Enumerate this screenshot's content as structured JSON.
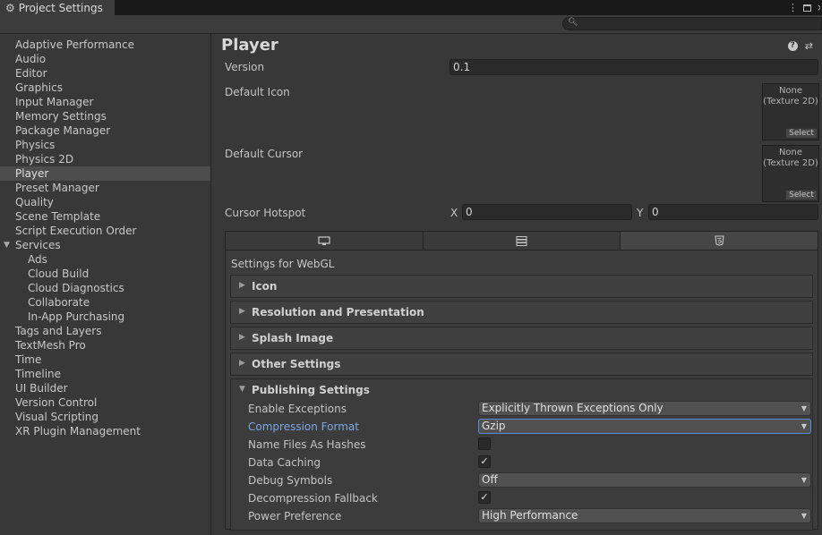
{
  "window": {
    "title": "Project Settings"
  },
  "sidebar": {
    "items": [
      {
        "label": "Adaptive Performance"
      },
      {
        "label": "Audio"
      },
      {
        "label": "Editor"
      },
      {
        "label": "Graphics"
      },
      {
        "label": "Input Manager"
      },
      {
        "label": "Memory Settings"
      },
      {
        "label": "Package Manager"
      },
      {
        "label": "Physics"
      },
      {
        "label": "Physics 2D"
      },
      {
        "label": "Player"
      },
      {
        "label": "Preset Manager"
      },
      {
        "label": "Quality"
      },
      {
        "label": "Scene Template"
      },
      {
        "label": "Script Execution Order"
      },
      {
        "label": "Services"
      },
      {
        "label": "Ads"
      },
      {
        "label": "Cloud Build"
      },
      {
        "label": "Cloud Diagnostics"
      },
      {
        "label": "Collaborate"
      },
      {
        "label": "In-App Purchasing"
      },
      {
        "label": "Tags and Layers"
      },
      {
        "label": "TextMesh Pro"
      },
      {
        "label": "Time"
      },
      {
        "label": "Timeline"
      },
      {
        "label": "UI Builder"
      },
      {
        "label": "Version Control"
      },
      {
        "label": "Visual Scripting"
      },
      {
        "label": "XR Plugin Management"
      }
    ],
    "selected": "Player"
  },
  "main": {
    "title": "Player",
    "version_label": "Version",
    "version_value": "0.1",
    "default_icon_label": "Default Icon",
    "default_cursor_label": "Default Cursor",
    "texture_none": "None",
    "texture_type": "(Texture 2D)",
    "select_label": "Select",
    "cursor_hotspot_label": "Cursor Hotspot",
    "x_label": "X",
    "x_value": "0",
    "y_label": "Y",
    "y_value": "0",
    "platform_tabs": [
      {
        "icon": "monitor-icon"
      },
      {
        "icon": "server-icon"
      },
      {
        "icon": "html5-icon"
      }
    ],
    "settings_for": "Settings for WebGL",
    "sections": [
      {
        "label": "Icon"
      },
      {
        "label": "Resolution and Presentation"
      },
      {
        "label": "Splash Image"
      },
      {
        "label": "Other Settings"
      },
      {
        "label": "Publishing Settings"
      }
    ],
    "publishing": {
      "enable_exceptions_label": "Enable Exceptions",
      "enable_exceptions_value": "Explicitly Thrown Exceptions Only",
      "compression_format_label": "Compression Format",
      "compression_format_value": "Gzip",
      "name_files_label": "Name Files As Hashes",
      "name_files_checked": false,
      "data_caching_label": "Data Caching",
      "data_caching_checked": true,
      "debug_symbols_label": "Debug Symbols",
      "debug_symbols_value": "Off",
      "decompression_fallback_label": "Decompression Fallback",
      "decompression_fallback_checked": true,
      "power_preference_label": "Power Preference",
      "power_preference_value": "High Performance"
    }
  },
  "colors": {
    "background": "#383838",
    "selected_row": "#4d4d4d",
    "highlight_text": "#7aa7e3"
  }
}
